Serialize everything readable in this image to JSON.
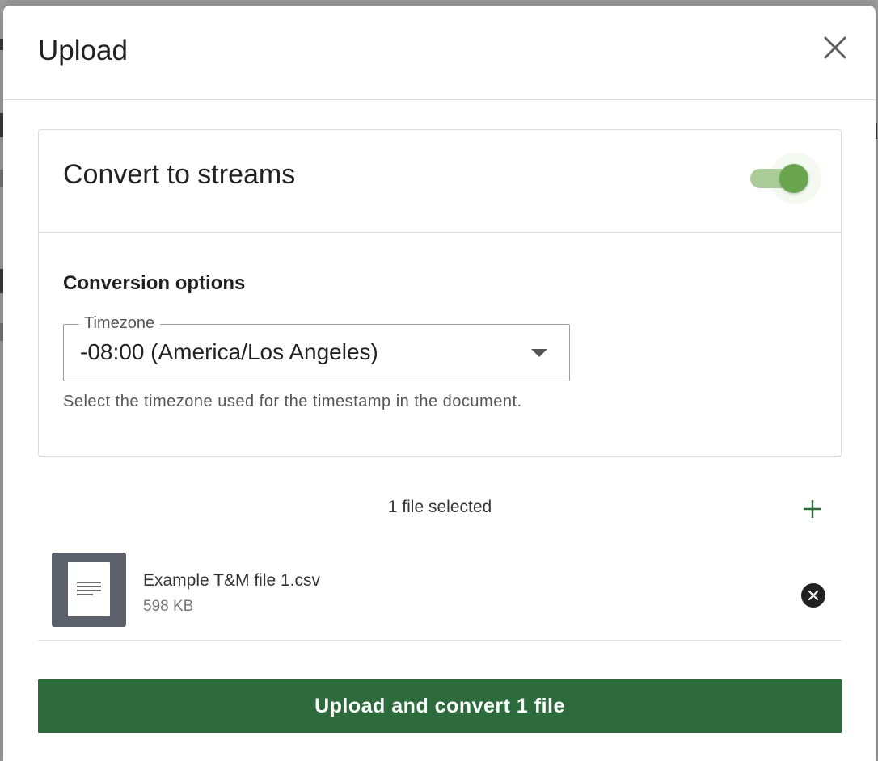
{
  "modal": {
    "title": "Upload"
  },
  "convert": {
    "title": "Convert to streams",
    "enabled": true
  },
  "conversion": {
    "section_title": "Conversion options",
    "timezone_label": "Timezone",
    "timezone_value": "-08:00 (America/Los Angeles)",
    "helper_text": "Select the timezone used for the timestamp in the document."
  },
  "files": {
    "count_label": "1 file selected",
    "items": [
      {
        "name": "Example T&M file 1.csv",
        "size": "598 KB"
      }
    ]
  },
  "submit": {
    "label": "Upload and convert 1 file"
  },
  "colors": {
    "primary": "#2e6b3c",
    "toggle_on": "#69a54e",
    "toggle_track": "#a9cc99"
  },
  "icons": {
    "close": "close-icon",
    "add": "plus-icon",
    "remove": "remove-circle-icon",
    "file": "document-icon",
    "dropdown": "caret-down-icon"
  }
}
